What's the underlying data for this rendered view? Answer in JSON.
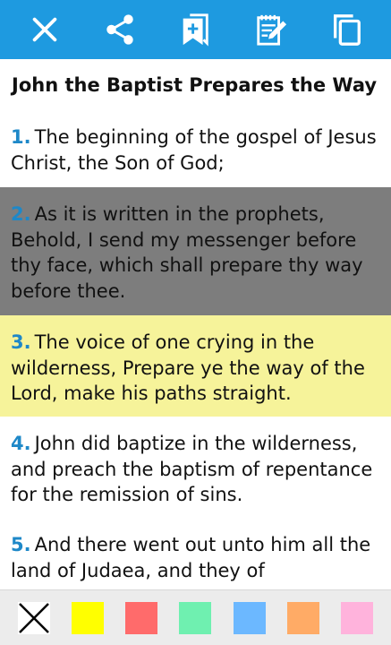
{
  "toolbar": {
    "background": "#1e9ae0",
    "buttons": [
      {
        "icon": "close-icon"
      },
      {
        "icon": "share-icon"
      },
      {
        "icon": "bookmark-add-icon"
      },
      {
        "icon": "note-edit-icon"
      },
      {
        "icon": "copy-icon"
      }
    ]
  },
  "passage": {
    "heading": "John the Baptist Prepares the Way",
    "verses": [
      {
        "number": "1.",
        "text": "The beginning of the gospel of Jesus Christ, the Son of God;",
        "highlight": "none"
      },
      {
        "number": "2.",
        "text": "As it is written in the prophets, Behold, I send my messenger before thy face, which shall prepare thy way before thee.",
        "highlight": "#7d7d7d"
      },
      {
        "number": "3.",
        "text": "The voice of one crying in the wilderness, Prepare ye the way of the Lord, make his paths straight.",
        "highlight": "#f6f39a"
      },
      {
        "number": "4.",
        "text": "John did baptize in the wilderness, and preach the baptism of repentance for the remission of sins.",
        "highlight": "none"
      },
      {
        "number": "5.",
        "text": "And there went out unto him all the land of Judaea, and they of",
        "highlight": "none"
      }
    ]
  },
  "palette": {
    "colors": [
      {
        "name": "clear",
        "hex": "#ffffff"
      },
      {
        "name": "yellow",
        "hex": "#ffff00"
      },
      {
        "name": "red",
        "hex": "#ff6b6b"
      },
      {
        "name": "green",
        "hex": "#6ff0b0"
      },
      {
        "name": "blue",
        "hex": "#6cb8ff"
      },
      {
        "name": "orange",
        "hex": "#ffab66"
      },
      {
        "name": "pink",
        "hex": "#ffb3dc"
      }
    ]
  }
}
